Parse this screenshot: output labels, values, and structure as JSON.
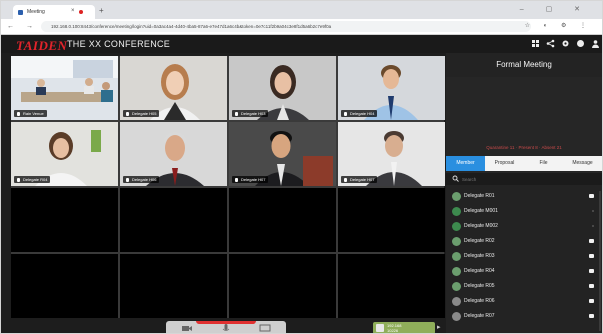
{
  "browser": {
    "tab_title": "Meeting",
    "tab_close": "×",
    "new_tab": "+",
    "window_controls": "– ▢ ✕",
    "nav": "← → ⟳",
    "url": "192.168.0.100:8443/conference/meeting/login?uid=0a3ac4a4-4d40-4ba5-87a6-e7e47d1a6c4b&token=0e7c11f2b9a04c3e8f1d5a6b2c7e9f0a",
    "extensions": "☆ ◐ ⚙ ⋮"
  },
  "header": {
    "brand": "TAIDEN",
    "title": "THE XX CONFERENCE",
    "icons": [
      "grid-icon",
      "share-icon",
      "gear-icon",
      "record-icon",
      "user-icon"
    ]
  },
  "grid": {
    "tiles": [
      {
        "name": "Rain Venue",
        "kind": "room"
      },
      {
        "name": "Delegate H05",
        "kind": "woman1"
      },
      {
        "name": "Delegate H03",
        "kind": "woman2"
      },
      {
        "name": "Delegate H04",
        "kind": "man1"
      },
      {
        "name": "Delegate R04",
        "kind": "woman3"
      },
      {
        "name": "Delegate H06",
        "kind": "man2"
      },
      {
        "name": "Delegate H07",
        "kind": "man3"
      },
      {
        "name": "Delegate H07",
        "kind": "man4"
      }
    ]
  },
  "toolbar": {
    "icons": [
      "camera-icon",
      "mic-icon",
      "screen-icon"
    ],
    "chip_line1": "192.168",
    "chip_line2": "10226",
    "chip_badge": "100"
  },
  "panel": {
    "title": "Formal Meeting",
    "stats": "Quarantine 11 · Present 8 · Absent 21",
    "tabs": [
      "Member",
      "Proposal",
      "File",
      "Message"
    ],
    "active_tab": 0,
    "search_placeholder": "Search",
    "delegates": [
      {
        "name": "Delegate R01",
        "color": "#6b9e6e",
        "mic": true
      },
      {
        "name": "Delegate M001",
        "color": "#3d8a4e",
        "mic": false
      },
      {
        "name": "Delegate M002",
        "color": "#3d8a4e",
        "mic": false
      },
      {
        "name": "Delegate R02",
        "color": "#6b9e6e",
        "mic": true
      },
      {
        "name": "Delegate R03",
        "color": "#6b9e6e",
        "mic": true
      },
      {
        "name": "Delegate R04",
        "color": "#6b9e6e",
        "mic": true
      },
      {
        "name": "Delegate R05",
        "color": "#6b9e6e",
        "mic": true
      },
      {
        "name": "Delegate R06",
        "color": "#8a8a8a",
        "mic": true
      },
      {
        "name": "Delegate R07",
        "color": "#8a8a8a",
        "mic": true
      }
    ]
  }
}
